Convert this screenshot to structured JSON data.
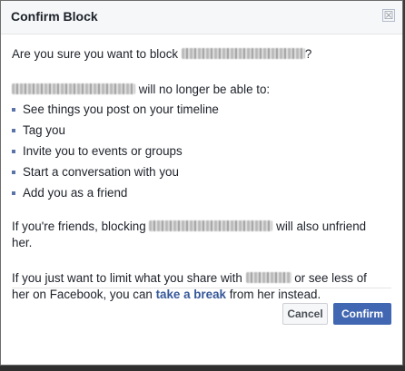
{
  "dialog": {
    "title": "Confirm Block",
    "close_symbol": "☒"
  },
  "content": {
    "question_prefix": "Are you sure you want to block ",
    "question_suffix": "?",
    "lead_suffix": " will no longer be able to:",
    "items": [
      "See things you post on your timeline",
      "Tag you",
      "Invite you to events or groups",
      "Start a conversation with you",
      "Add you as a friend"
    ],
    "friends_prefix": "If you're friends, blocking ",
    "friends_suffix": " will also unfriend her.",
    "limit_prefix": "If you just want to limit what you share with ",
    "limit_middle": " or see less of her on Facebook, you can ",
    "limit_link": "take a break",
    "limit_suffix": " from her instead."
  },
  "buttons": {
    "cancel": "Cancel",
    "confirm": "Confirm"
  },
  "colors": {
    "primary": "#4267b2",
    "link": "#365899"
  },
  "icons": {
    "close": "close-icon",
    "bullet": "bullet-icon"
  }
}
